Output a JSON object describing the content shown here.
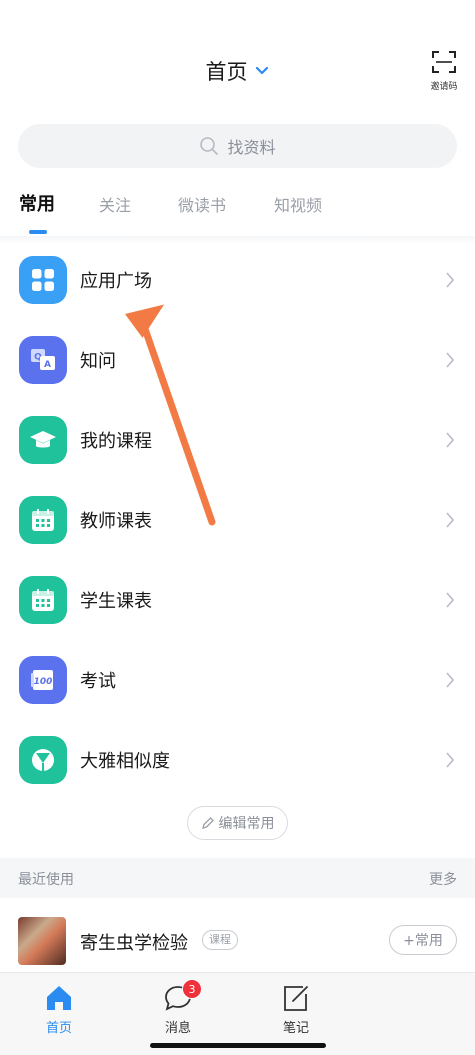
{
  "header": {
    "title": "首页",
    "invite_label": "邀请码"
  },
  "search": {
    "placeholder": "找资料"
  },
  "tabs": [
    {
      "label": "常用",
      "active": true
    },
    {
      "label": "关注",
      "active": false
    },
    {
      "label": "微读书",
      "active": false
    },
    {
      "label": "知视频",
      "active": false
    }
  ],
  "common_apps": [
    {
      "label": "应用广场",
      "icon": "app-grid-icon",
      "color": "#3aa0f5"
    },
    {
      "label": "知问",
      "icon": "qa-icon",
      "color": "#5a72ee"
    },
    {
      "label": "我的课程",
      "icon": "graduation-cap-icon",
      "color": "#1fc29a"
    },
    {
      "label": "教师课表",
      "icon": "calendar-icon",
      "color": "#1fc29a"
    },
    {
      "label": "学生课表",
      "icon": "calendar-icon",
      "color": "#1fc29a"
    },
    {
      "label": "考试",
      "icon": "exam-paper-icon",
      "color": "#5a72ee"
    },
    {
      "label": "大雅相似度",
      "icon": "similarity-icon",
      "color": "#1fc29a"
    }
  ],
  "edit_button": {
    "label": "编辑常用"
  },
  "recent": {
    "title": "最近使用",
    "more": "更多",
    "item": {
      "name": "寄生虫学检验",
      "tag": "课程",
      "action": "+常用"
    }
  },
  "bottom_nav": [
    {
      "label": "首页",
      "icon": "home-icon",
      "active": true
    },
    {
      "label": "消息",
      "icon": "chat-bubble-icon",
      "badge": "3"
    },
    {
      "label": "笔记",
      "icon": "note-edit-icon"
    }
  ],
  "colors": {
    "accent": "#2a8cf0",
    "arrow": "#f27a45",
    "badge": "#f0303a"
  }
}
